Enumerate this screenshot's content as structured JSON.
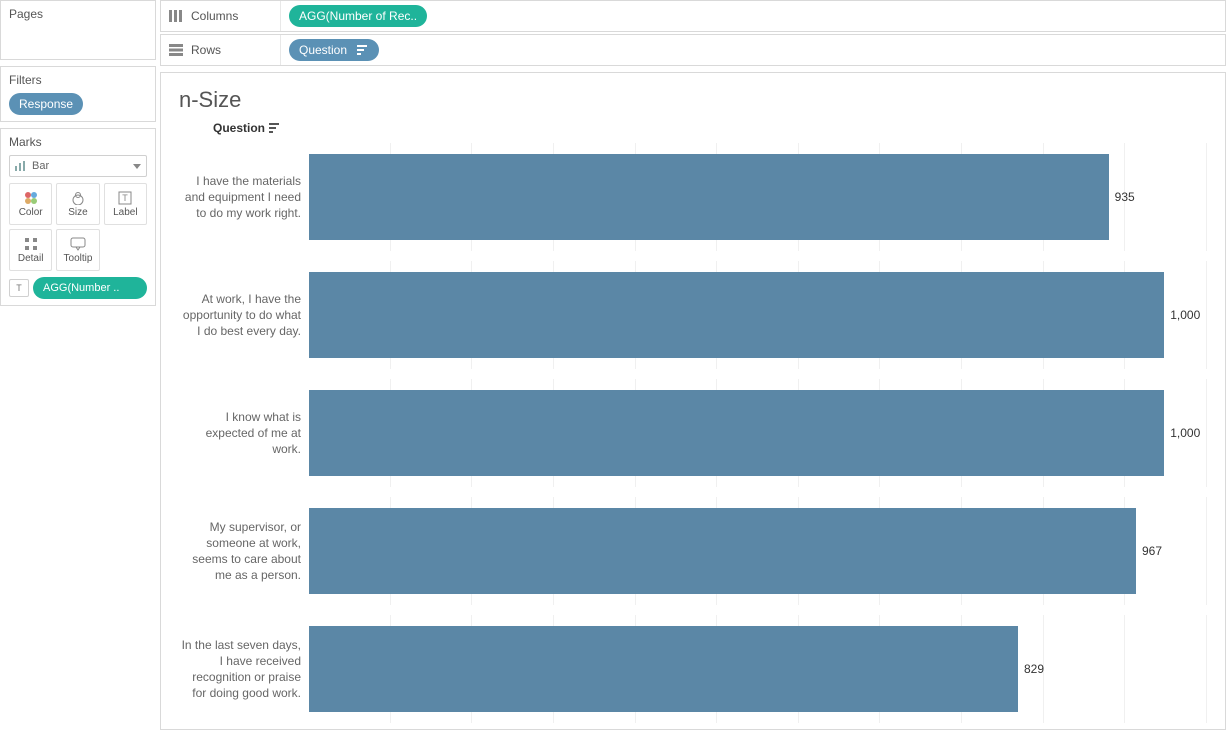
{
  "pages": {
    "title": "Pages"
  },
  "filters": {
    "title": "Filters",
    "items": [
      "Response"
    ]
  },
  "marks": {
    "title": "Marks",
    "type_label": "Bar",
    "cells": [
      "Color",
      "Size",
      "Label",
      "Detail",
      "Tooltip"
    ],
    "encoding_pill": "AGG(Number .."
  },
  "shelves": {
    "columns_label": "Columns",
    "columns_pill": "AGG(Number of Rec..",
    "rows_label": "Rows",
    "rows_pill": "Question"
  },
  "viz": {
    "title": "n-Size",
    "axis_header": "Question"
  },
  "chart_data": {
    "type": "bar",
    "orientation": "horizontal",
    "xlabel": "",
    "ylabel": "Question",
    "xlim": [
      0,
      1050
    ],
    "categories": [
      "I have the materials and equipment I need to do my work right.",
      "At work, I have the opportunity to do what I do best every day.",
      "I know what is expected of me at work.",
      "My supervisor, or someone at work, seems to care about me as a person.",
      "In the last seven days, I have received recognition or praise for doing good work."
    ],
    "values": [
      935,
      1000,
      1000,
      967,
      829
    ],
    "value_labels": [
      "935",
      "1,000",
      "1,000",
      "967",
      "829"
    ],
    "bar_color": "#5b87a6"
  }
}
